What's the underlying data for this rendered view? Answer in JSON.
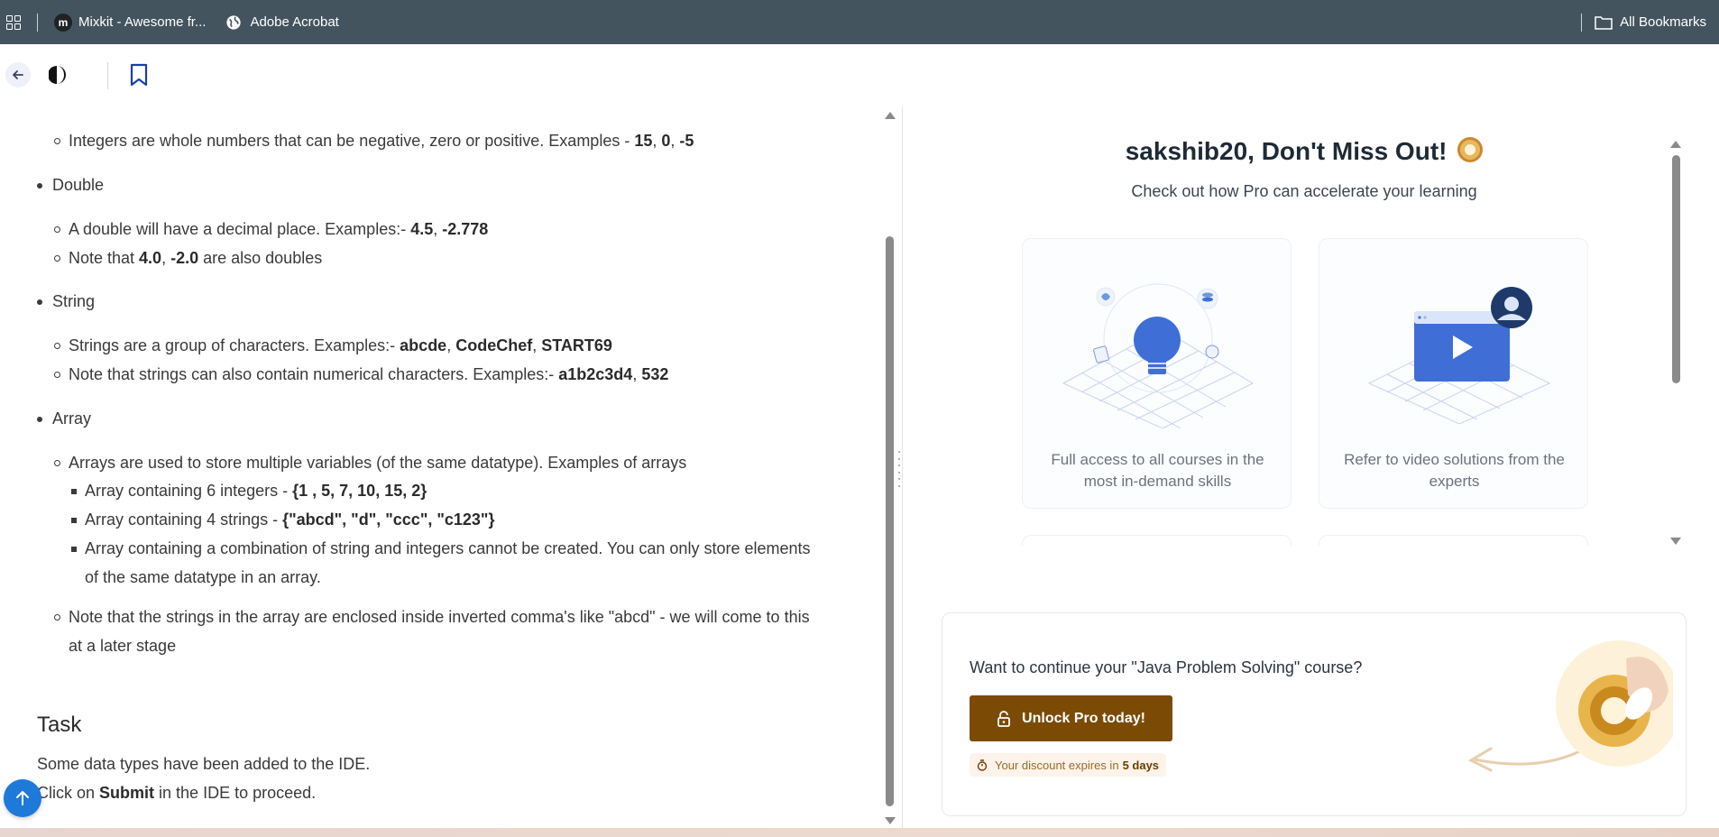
{
  "bookmarks": {
    "items": [
      {
        "label": "Mixkit - Awesome fr...",
        "favicon": "m"
      },
      {
        "label": "Adobe Acrobat",
        "favicon": "globe-icon"
      }
    ],
    "all_bookmarks": "All Bookmarks"
  },
  "lesson": {
    "integers_note": {
      "text": "Integers are whole numbers that can be negative, zero or positive. Examples - ",
      "v1": "15",
      "v2": "0",
      "v3": "-5"
    },
    "double": {
      "label": "Double",
      "note1": {
        "text": "A double will have a decimal place. Examples:- ",
        "v1": "4.5",
        "v2": "-2.778"
      },
      "note2": {
        "pre": "Note that ",
        "v1": "4.0",
        "v2": "-2.0",
        "post": " are also doubles"
      }
    },
    "string": {
      "label": "String",
      "note1": {
        "text": "Strings are a group of characters. Examples:- ",
        "v1": "abcde",
        "v2": "CodeChef",
        "v3": "START69"
      },
      "note2": {
        "text": "Note that strings can also contain numerical characters. Examples:- ",
        "v1": "a1b2c3d4",
        "v2": "532"
      }
    },
    "array": {
      "label": "Array",
      "note1": "Arrays are used to store multiple variables (of the same datatype). Examples of arrays",
      "sub1": {
        "text": "Array containing 6 integers - ",
        "v": "{1 , 5, 7, 10, 15, 2}"
      },
      "sub2": {
        "text": "Array containing 4 strings - ",
        "v": "{\"abcd\", \"d\", \"ccc\", \"c123\"}"
      },
      "sub3_line1": "Array containing a combination of string and integers cannot be created. You can only store elements",
      "sub3_line2": "of the same datatype in an array.",
      "note2_line1": "Note that the strings in the array are enclosed inside inverted comma's like \"abcd\" - we will come to this",
      "note2_line2": "at a later stage"
    },
    "task": {
      "heading": "Task",
      "line1": "Some data types have been added to the IDE.",
      "line2_pre": "Click on ",
      "line2_bold": "Submit",
      "line2_post": " in the IDE to proceed."
    }
  },
  "promo": {
    "title": "sakshib20, Don't Miss Out!",
    "subtitle": "Check out how Pro can accelerate your learning",
    "cards": [
      {
        "line1": "Full access to all courses in the",
        "line2": "most in-demand skills"
      },
      {
        "line1": "Refer to video solutions from the",
        "line2": "experts"
      }
    ],
    "unlock": {
      "question": "Want to continue your \"Java Problem Solving\" course?",
      "button": "Unlock Pro today!",
      "discount_text": "Your discount expires in",
      "discount_days": "5 days"
    }
  },
  "colors": {
    "bookmarks_bar": "#44545f",
    "unlock_button": "#7b4b06",
    "fab": "#1e79d8",
    "accent_blue": "#3f6fd6"
  }
}
